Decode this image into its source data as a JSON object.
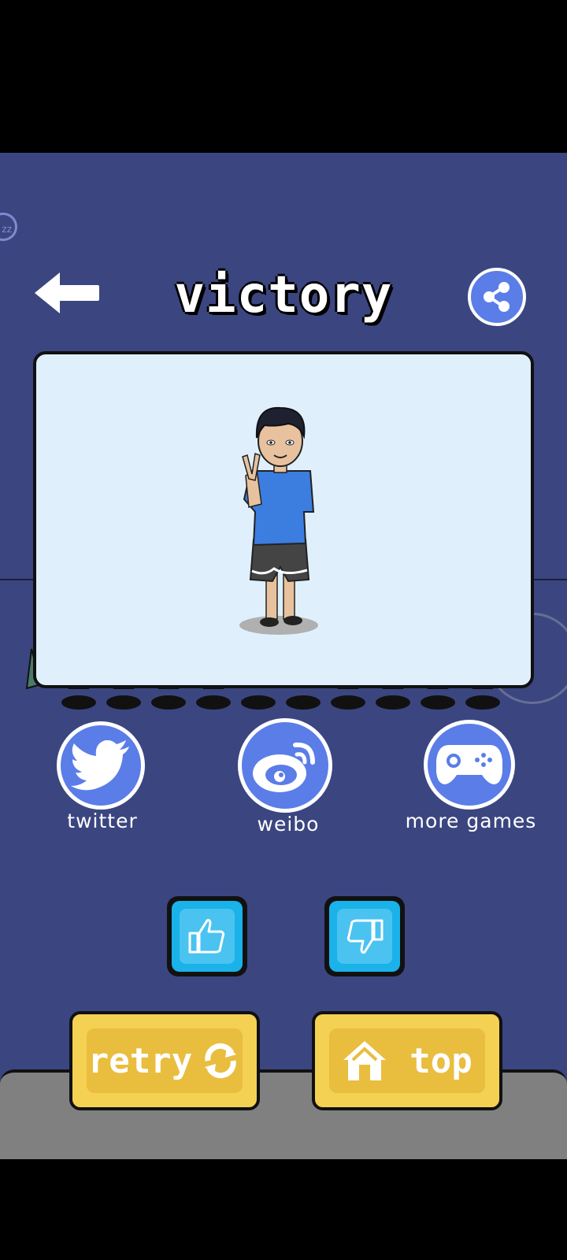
{
  "header": {
    "title": "victory",
    "back_icon": "arrow-left-icon",
    "share_icon": "share-icon"
  },
  "overlay": {
    "sleep_badge": "zz"
  },
  "social": [
    {
      "label": "twitter",
      "icon": "twitter-icon"
    },
    {
      "label": "weibo",
      "icon": "weibo-icon"
    },
    {
      "label": "more games",
      "icon": "gamepad-icon"
    }
  ],
  "rating": {
    "like_icon": "thumbs-up-icon",
    "dislike_icon": "thumbs-down-icon"
  },
  "actions": {
    "retry_label": "retry",
    "top_label": "top"
  },
  "colors": {
    "background": "#3b4680",
    "accent_blue": "#5b7de8",
    "card": "#dff0fc",
    "button_yellow": "#f5d153",
    "rate_cyan": "#1ab2e8"
  }
}
